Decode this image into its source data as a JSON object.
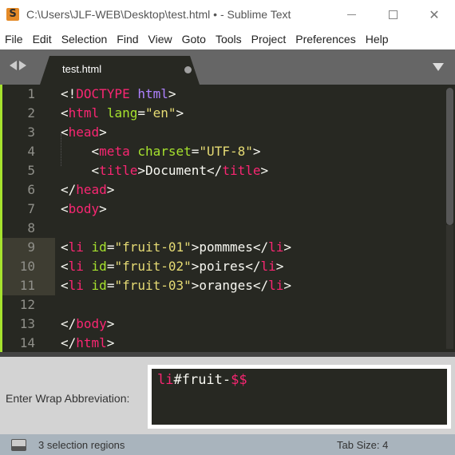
{
  "window": {
    "title": "C:\\Users\\JLF-WEB\\Desktop\\test.html • - Sublime Text",
    "app_icon": "S",
    "controls": [
      "minimize",
      "maximize",
      "close"
    ]
  },
  "menu": [
    "File",
    "Edit",
    "Selection",
    "Find",
    "View",
    "Goto",
    "Tools",
    "Project",
    "Preferences",
    "Help"
  ],
  "tabs": [
    {
      "label": "test.html",
      "dirty": true,
      "active": true
    }
  ],
  "editor": {
    "line_numbers": [
      "1",
      "2",
      "3",
      "4",
      "5",
      "6",
      "7",
      "8",
      "9",
      "10",
      "11",
      "12",
      "13",
      "14"
    ],
    "selected_lines": [
      9,
      10,
      11
    ],
    "lines": [
      [
        [
          "t-punct",
          "<!"
        ],
        [
          "t-tag",
          "DOCTYPE"
        ],
        [
          "t-punct",
          " "
        ],
        [
          "t-doctype",
          "html"
        ],
        [
          "t-punct",
          ">"
        ]
      ],
      [
        [
          "t-punct",
          "<"
        ],
        [
          "t-tag",
          "html"
        ],
        [
          "t-punct",
          " "
        ],
        [
          "t-attr",
          "lang"
        ],
        [
          "t-punct",
          "="
        ],
        [
          "t-str",
          "\"en\""
        ],
        [
          "t-punct",
          ">"
        ]
      ],
      [
        [
          "t-punct",
          "<"
        ],
        [
          "t-tag",
          "head"
        ],
        [
          "t-punct",
          ">"
        ]
      ],
      [
        [
          "t-punct",
          "    <"
        ],
        [
          "t-tag",
          "meta"
        ],
        [
          "t-punct",
          " "
        ],
        [
          "t-attr",
          "charset"
        ],
        [
          "t-punct",
          "="
        ],
        [
          "t-str",
          "\"UTF-8\""
        ],
        [
          "t-punct",
          ">"
        ]
      ],
      [
        [
          "t-punct",
          "    <"
        ],
        [
          "t-tag",
          "title"
        ],
        [
          "t-punct",
          ">Document</"
        ],
        [
          "t-tag",
          "title"
        ],
        [
          "t-punct",
          ">"
        ]
      ],
      [
        [
          "t-punct",
          "</"
        ],
        [
          "t-tag",
          "head"
        ],
        [
          "t-punct",
          ">"
        ]
      ],
      [
        [
          "t-punct",
          "<"
        ],
        [
          "t-tag",
          "body"
        ],
        [
          "t-punct",
          ">"
        ]
      ],
      [],
      [
        [
          "t-punct",
          "<"
        ],
        [
          "t-tag",
          "li"
        ],
        [
          "t-punct",
          " "
        ],
        [
          "t-attr",
          "id"
        ],
        [
          "t-punct",
          "="
        ],
        [
          "t-str",
          "\"fruit-01\""
        ],
        [
          "t-punct",
          ">pommmes</"
        ],
        [
          "t-tag",
          "li"
        ],
        [
          "t-punct",
          ">"
        ]
      ],
      [
        [
          "t-punct",
          "<"
        ],
        [
          "t-tag",
          "li"
        ],
        [
          "t-punct",
          " "
        ],
        [
          "t-attr",
          "id"
        ],
        [
          "t-punct",
          "="
        ],
        [
          "t-str",
          "\"fruit-02\""
        ],
        [
          "t-punct",
          ">poires</"
        ],
        [
          "t-tag",
          "li"
        ],
        [
          "t-punct",
          ">"
        ]
      ],
      [
        [
          "t-punct",
          "<"
        ],
        [
          "t-tag",
          "li"
        ],
        [
          "t-punct",
          " "
        ],
        [
          "t-attr",
          "id"
        ],
        [
          "t-punct",
          "="
        ],
        [
          "t-str",
          "\"fruit-03\""
        ],
        [
          "t-punct",
          ">oranges</"
        ],
        [
          "t-tag",
          "li"
        ],
        [
          "t-punct",
          ">"
        ]
      ],
      [],
      [
        [
          "t-punct",
          "</"
        ],
        [
          "t-tag",
          "body"
        ],
        [
          "t-punct",
          ">"
        ]
      ],
      [
        [
          "t-punct",
          "</"
        ],
        [
          "t-tag",
          "html"
        ],
        [
          "t-punct",
          ">"
        ]
      ]
    ]
  },
  "wrap_panel": {
    "label": "Enter Wrap Abbreviation:",
    "value_tokens": [
      [
        "t-tag",
        "li"
      ],
      [
        "t-punct",
        "#fruit-"
      ],
      [
        "t-tag",
        "$$"
      ]
    ]
  },
  "status": {
    "selection_text": "3 selection regions",
    "tab_size": "Tab Size: 4"
  },
  "colors": {
    "editor_bg": "#272822",
    "tag": "#f92672",
    "attr": "#a6e22e",
    "string": "#e6db74",
    "doctype": "#ae81ff",
    "statusbar_bg": "#a9b4bd"
  }
}
